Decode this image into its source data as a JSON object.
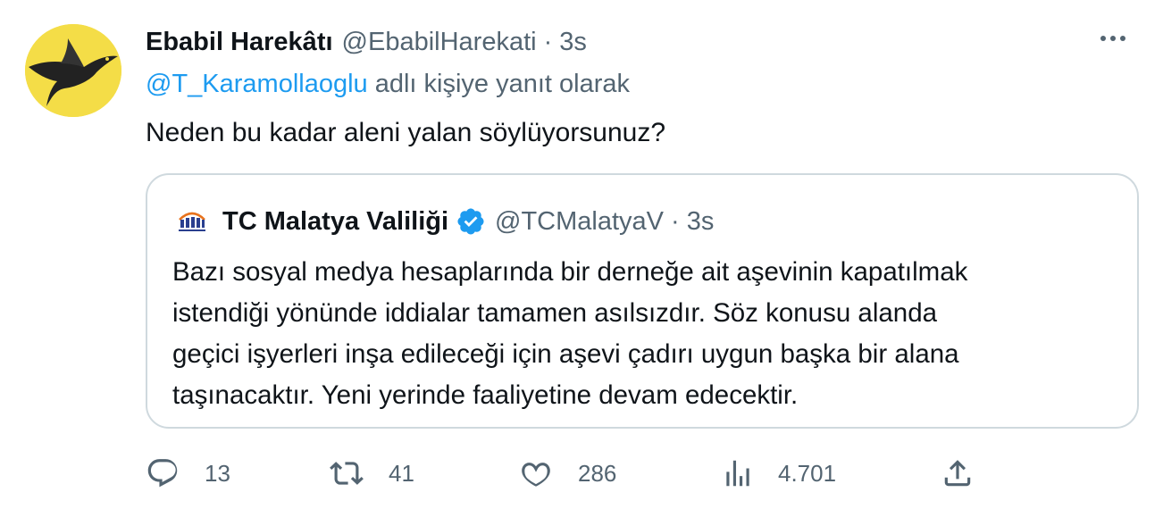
{
  "tweet": {
    "display_name": "Ebabil Harekâtı",
    "handle": "@EbabilHarekati",
    "separator": "·",
    "time": "3s",
    "reply_mention": "@T_Karamollaoglu",
    "reply_suffix": "adlı kişiye yanıt olarak",
    "text": "Neden bu kadar aleni yalan söylüyorsunuz?",
    "avatar_bg": "#f4dd47"
  },
  "quote": {
    "display_name": "TC Malatya Valiliği",
    "handle": "@TCMalatyaV",
    "separator": "·",
    "time": "3s",
    "verified": true,
    "lines": [
      "Bazı sosyal medya hesaplarında bir derneğe ait aşevinin kapatılmak",
      "istendiği yönünde iddialar tamamen asılsızdır. Söz konusu alanda",
      "geçici işyerleri inşa edileceği için aşevi çadırı uygun başka bir alana",
      "taşınacaktır. Yeni yerinde faaliyetine devam edecektir."
    ]
  },
  "actions": {
    "replies": "13",
    "retweets": "41",
    "likes": "286",
    "views": "4.701"
  },
  "icons": {
    "more": "more-icon",
    "reply": "reply-icon",
    "retweet": "retweet-icon",
    "like": "heart-icon",
    "views": "analytics-icon",
    "share": "share-icon",
    "verified": "verified-badge-icon"
  },
  "colors": {
    "link": "#1d9bf0",
    "secondary_text": "#536471",
    "primary_text": "#0f1419",
    "border": "#cfd9de",
    "verified": "#1d9bf0"
  }
}
